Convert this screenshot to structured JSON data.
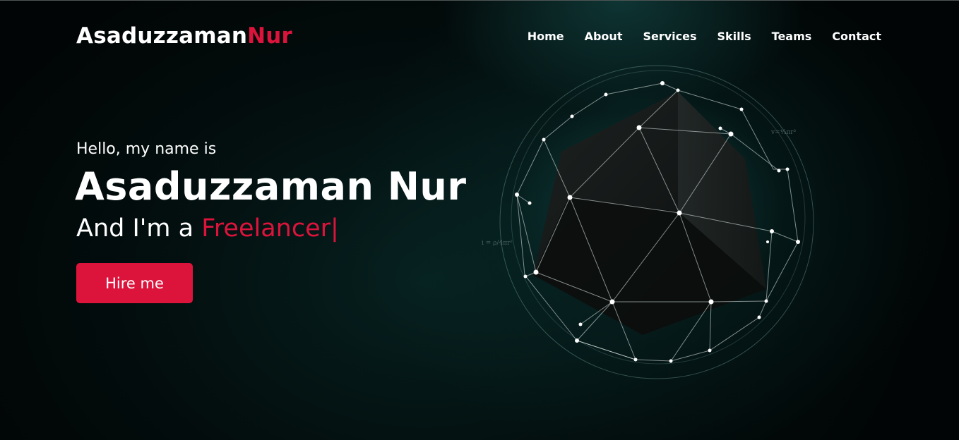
{
  "brand": {
    "first": "Asaduzzaman",
    "last": "Nur"
  },
  "nav": {
    "items": [
      {
        "label": "Home"
      },
      {
        "label": "About"
      },
      {
        "label": "Services"
      },
      {
        "label": "Skills"
      },
      {
        "label": "Teams"
      },
      {
        "label": "Contact"
      }
    ]
  },
  "hero": {
    "greeting": "Hello, my name is",
    "name": "Asaduzzaman Nur",
    "role_prefix": "And I'm a ",
    "role_typed": "Freelancer",
    "cursor": "|",
    "cta_label": "Hire me"
  },
  "illustration": {
    "formula_right": "v=⁴⁄₃πr³",
    "formula_left": "i = ρ/4πr²"
  },
  "colors": {
    "accent": "#dc143c",
    "text": "#ffffff",
    "background": "#030d0d"
  }
}
